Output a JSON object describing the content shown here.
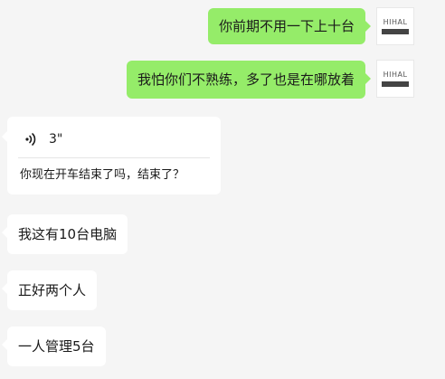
{
  "messages": [
    {
      "id": "m1",
      "direction": "sent",
      "text": "你前期不用一下上十台"
    },
    {
      "id": "m2",
      "direction": "sent",
      "text": "我怕你们不熟练，多了也是在哪放着"
    },
    {
      "id": "m3",
      "direction": "received",
      "type": "voice",
      "duration": "3\"",
      "transcript": "你现在开车结束了吗，结束了？"
    },
    {
      "id": "m4",
      "direction": "received",
      "text": "我这有10台电脑"
    },
    {
      "id": "m5",
      "direction": "received",
      "text": "正好两个人"
    },
    {
      "id": "m6",
      "direction": "received",
      "text": "一人管理5台"
    }
  ],
  "avatar": {
    "logo_text": "HIHAL"
  },
  "colors": {
    "background": "#f5f5f5",
    "sent_bubble": "#95ec69",
    "received_bubble": "#ffffff"
  }
}
